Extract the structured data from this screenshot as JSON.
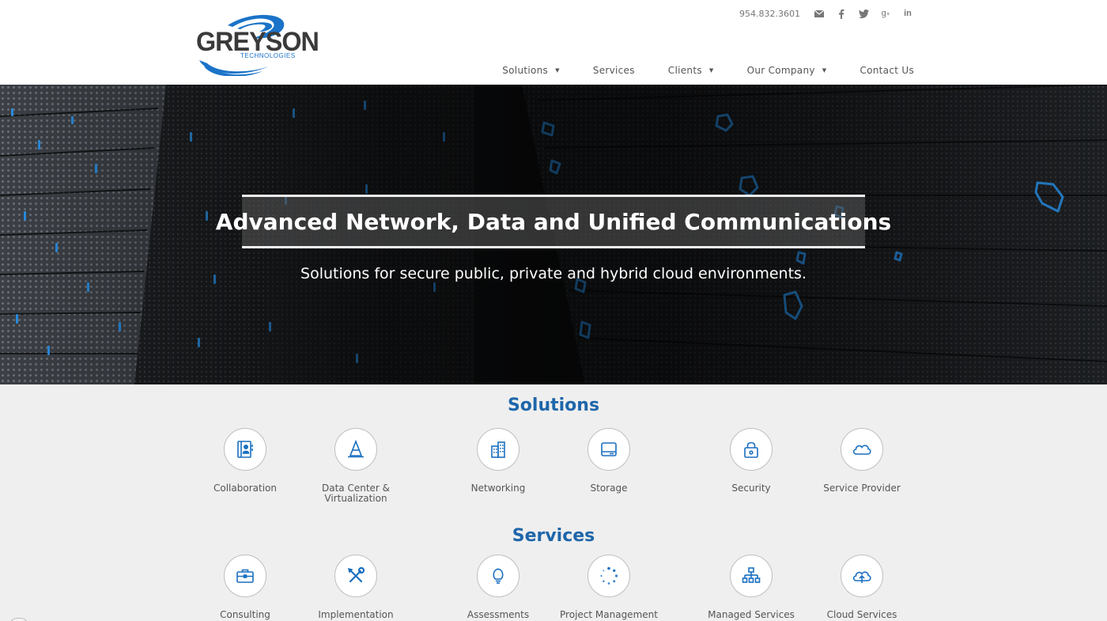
{
  "brand": {
    "name": "GREYSON",
    "tagline": "TECHNOLOGIES",
    "logo_color": "#1a73c8",
    "text_color": "#3a3a3a"
  },
  "topbar": {
    "phone": "954.832.3601",
    "icons": [
      {
        "name": "email-icon",
        "glyph": "✉"
      },
      {
        "name": "facebook-icon",
        "glyph": "f"
      },
      {
        "name": "twitter-icon",
        "glyph": "t"
      },
      {
        "name": "google-plus-icon",
        "glyph": "g+"
      },
      {
        "name": "linkedin-icon",
        "glyph": "in"
      }
    ]
  },
  "nav": {
    "items": [
      {
        "label": "Solutions",
        "has_dropdown": true
      },
      {
        "label": "Services",
        "has_dropdown": false
      },
      {
        "label": "Clients",
        "has_dropdown": true
      },
      {
        "label": "Our Company",
        "has_dropdown": true
      },
      {
        "label": "Contact Us",
        "has_dropdown": false
      }
    ]
  },
  "hero": {
    "title": "Advanced Network, Data and Unified Communications",
    "subtitle": "Solutions for secure public, private and hybrid cloud environments."
  },
  "solutions": {
    "title": "Solutions",
    "items": [
      {
        "label": "Collaboration",
        "icon": "address-book-icon"
      },
      {
        "label": "Data Center &\nVirtualization",
        "icon": "cone-icon"
      },
      {
        "label": "Networking",
        "icon": "building-icon"
      },
      {
        "label": "Storage",
        "icon": "hard-drive-icon"
      },
      {
        "label": "Security",
        "icon": "lock-icon"
      },
      {
        "label": "Service Provider",
        "icon": "cloud-icon"
      }
    ]
  },
  "services": {
    "title": "Services",
    "items": [
      {
        "label": "Consulting",
        "icon": "briefcase-icon"
      },
      {
        "label": "Implementation",
        "icon": "tools-icon"
      },
      {
        "label": "Assessments",
        "icon": "lightbulb-icon"
      },
      {
        "label": "Project Management",
        "icon": "spinner-icon"
      },
      {
        "label": "Managed Services",
        "icon": "sitemap-icon"
      },
      {
        "label": "Cloud Services",
        "icon": "cloud-upload-icon"
      }
    ]
  },
  "colors": {
    "accent": "#1f66aa",
    "icon_blue": "#1a6fc0",
    "page_bg": "#efefef"
  }
}
